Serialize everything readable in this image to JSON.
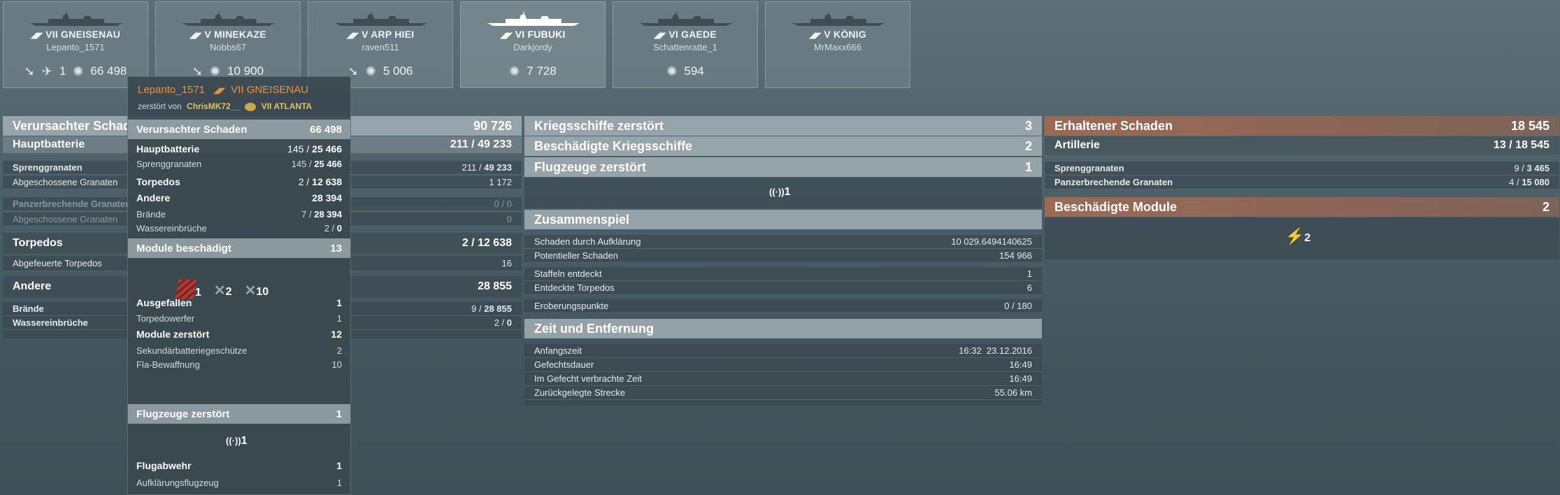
{
  "ships": [
    {
      "tier_name": "VII GNEISENAU",
      "player": "Lepanto_1571",
      "stat1": "",
      "stat2": "1",
      "damage": "66 498",
      "icons": [
        "torpedo-icon",
        "plane-icon",
        "explosion-icon"
      ]
    },
    {
      "tier_name": "V MINEKAZE",
      "player": "Nobbs67",
      "stat1": "",
      "stat2": "",
      "damage": "10 900",
      "icons": [
        "torpedo-icon",
        "explosion-icon"
      ]
    },
    {
      "tier_name": "V ARP HIEI",
      "player": "raven511",
      "stat1": "",
      "stat2": "",
      "damage": "5 006",
      "icons": [
        "torpedo-icon",
        "explosion-icon"
      ]
    },
    {
      "tier_name": "VI FUBUKI",
      "player": "Darkjordy",
      "stat1": "",
      "stat2": "",
      "damage": "7 728",
      "icons": [
        "explosion-icon"
      ]
    },
    {
      "tier_name": "VI GAEDE",
      "player": "Schattenratte_1",
      "stat1": "",
      "stat2": "",
      "damage": "594",
      "icons": [
        "explosion-icon"
      ]
    },
    {
      "tier_name": "V KÖNIG",
      "player": "MrMaxx666",
      "stat1": "",
      "stat2": "",
      "damage": "",
      "icons": []
    }
  ],
  "left_panel": {
    "header": {
      "label": "Verursachter Schaden",
      "value": "90 726"
    },
    "main_battery": {
      "label": "Hauptbatterie",
      "hits": "211",
      "total": "49 233"
    },
    "he": {
      "label": "Sprenggranaten",
      "hits": "211",
      "total": "49 233"
    },
    "he_fired": {
      "label": "Abgeschossene Granaten",
      "value": "1 172"
    },
    "ap": {
      "label": "Panzerbrechende Granaten",
      "value": "0 / 0"
    },
    "ap_fired": {
      "label": "Abgeschossene Granaten",
      "value": "0"
    },
    "torpedoes": {
      "label": "Torpedos",
      "hits": "2",
      "total": "12 638"
    },
    "torps_fired": {
      "label": "Abgefeuerte Torpedos",
      "value": "16"
    },
    "other": {
      "label": "Andere",
      "value": "28 855"
    },
    "fires": {
      "label": "Brände",
      "hits": "9",
      "total": "28 855"
    },
    "floods": {
      "label": "Wassereinbrüche",
      "hits": "2",
      "total": "0"
    }
  },
  "middle_panel": {
    "ships_destroyed": {
      "label": "Kriegsschiffe zerstört",
      "value": "3"
    },
    "ships_damaged": {
      "label": "Beschädigte Kriegsschiffe",
      "value": "2"
    },
    "planes_destroyed": {
      "label": "Flugzeuge zerstört",
      "value": "1"
    },
    "plane_icon_count": "1",
    "teamplay": {
      "label": "Zusammenspiel"
    },
    "spotting_damage": {
      "label": "Schaden durch Aufklärung",
      "value": "10 029.6494140625"
    },
    "potential_damage": {
      "label": "Potentieller Schaden",
      "value": "154 966"
    },
    "squadrons_spotted": {
      "label": "Staffeln entdeckt",
      "value": "1"
    },
    "torps_spotted": {
      "label": "Entdeckte Torpedos",
      "value": "6"
    },
    "capture_points": {
      "label": "Eroberungspunkte",
      "value": "0 / 180"
    },
    "time": {
      "label": "Zeit und Entfernung"
    },
    "start_time": {
      "label": "Anfangszeit",
      "value": "16:32  23.12.2016"
    },
    "battle_duration": {
      "label": "Gefechtsdauer",
      "value": "16:49"
    },
    "time_in_battle": {
      "label": "Im Gefecht verbrachte Zeit",
      "value": "16:49"
    },
    "distance": {
      "label": "Zurückgelegte Strecke",
      "value": "55.06 km"
    }
  },
  "right_panel": {
    "received": {
      "label": "Erhaltener Schaden",
      "value": "18 545"
    },
    "artillery": {
      "label": "Artillerie",
      "hits": "13",
      "total": "18 545"
    },
    "he": {
      "label": "Sprenggranaten",
      "hits": "9",
      "total": "3 465"
    },
    "ap": {
      "label": "Panzerbrechende Granaten",
      "hits": "4",
      "total": "15 080"
    },
    "modules": {
      "label": "Beschädigte Module",
      "value": "2"
    },
    "module_icon_count": "2"
  },
  "popup": {
    "player": "Lepanto_1571",
    "ship": "VII GNEISENAU",
    "destroyed_by_label": "zerstört von",
    "killer": "ChrisMK72__",
    "killer_ship": "VII ATLANTA",
    "dmg": {
      "label": "Verursachter Schaden",
      "value": "66 498"
    },
    "main_battery": {
      "label": "Hauptbatterie",
      "hits": "145",
      "total": "25 466"
    },
    "he": {
      "label": "Sprenggranaten",
      "hits": "145",
      "total": "25 466"
    },
    "torpedoes": {
      "label": "Torpedos",
      "hits": "2",
      "total": "12 638"
    },
    "other": {
      "label": "Andere",
      "value": "28 394"
    },
    "fires": {
      "label": "Brände",
      "hits": "7",
      "total": "28 394"
    },
    "floods": {
      "label": "Wassereinbrüche",
      "hits": "2",
      "total": "0"
    },
    "modules_damaged": {
      "label": "Module beschädigt",
      "value": "13"
    },
    "module_counts": [
      "1",
      "2",
      "10"
    ],
    "disabled": {
      "label": "Ausgefallen",
      "value": "1"
    },
    "torp_launcher": {
      "label": "Torpedowerfer",
      "value": "1"
    },
    "modules_destroyed": {
      "label": "Module zerstört",
      "value": "12"
    },
    "secondary": {
      "label": "Sekundärbatteriegeschütze",
      "value": "2"
    },
    "aa": {
      "label": "Fla-Bewaffnung",
      "value": "10"
    },
    "planes_destroyed": {
      "label": "Flugzeuge zerstört",
      "value": "1"
    },
    "plane_count": "1",
    "flak": {
      "label": "Flugabwehr",
      "value": "1"
    },
    "scout": {
      "label": "Aufklärungsflugzeug",
      "value": "1"
    }
  },
  "colors": {
    "accent_orange": "#e8913e",
    "killer_gold": "#e2c25a",
    "received_bar": "#9b6a55"
  }
}
